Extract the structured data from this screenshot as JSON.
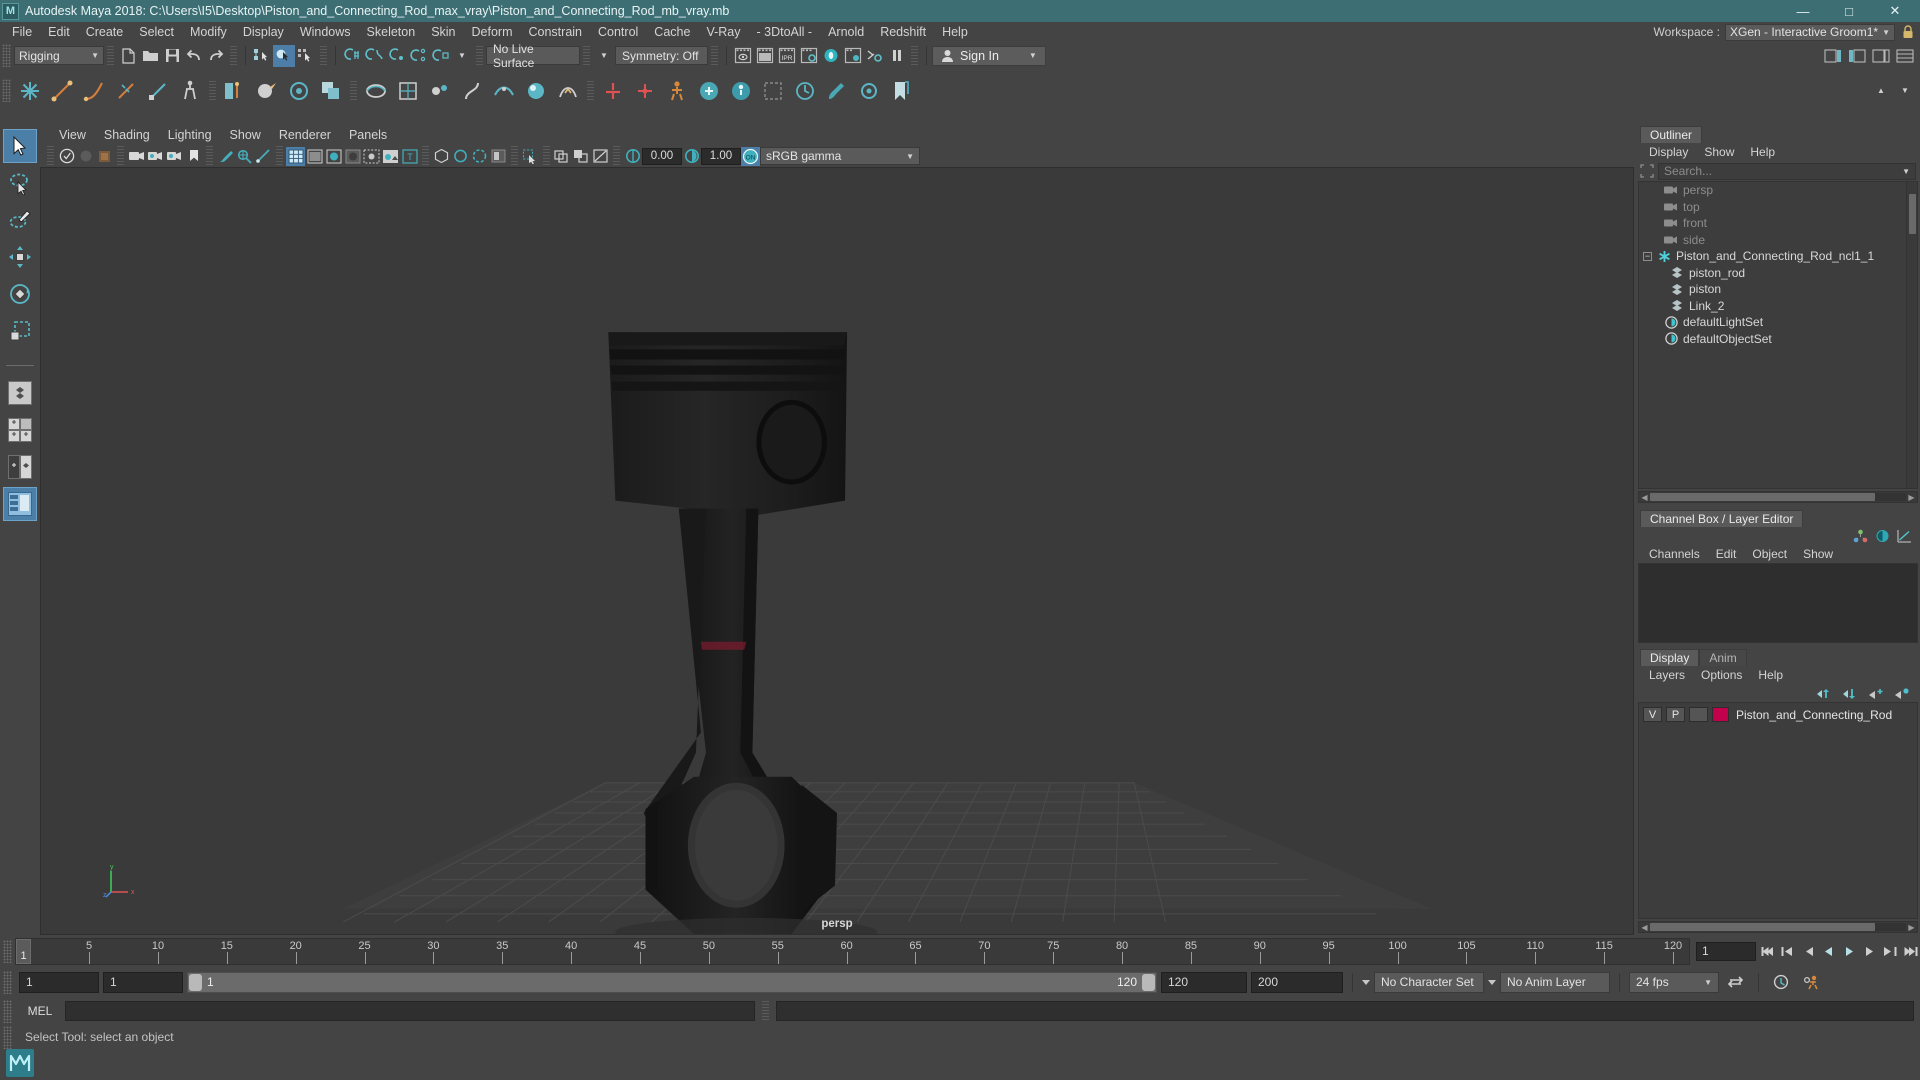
{
  "titlebar": {
    "app_title": "Autodesk Maya 2018: C:\\Users\\I5\\Desktop\\Piston_and_Connecting_Rod_max_vray\\Piston_and_Connecting_Rod_mb_vray.mb",
    "logo": "M",
    "minimize": "—",
    "maximize": "□",
    "close": "✕"
  },
  "menubar": {
    "items": [
      "File",
      "Edit",
      "Create",
      "Select",
      "Modify",
      "Display",
      "Windows",
      "Skeleton",
      "Skin",
      "Deform",
      "Constrain",
      "Control",
      "Cache",
      "V-Ray",
      "- 3DtoAll -",
      "Arnold",
      "Redshift",
      "Help"
    ],
    "workspace_label": "Workspace :",
    "workspace_value": "XGen - Interactive Groom1*"
  },
  "statusline": {
    "mode": "Rigging",
    "live_surface": "No Live Surface",
    "symmetry": "Symmetry: Off",
    "signin": "Sign In"
  },
  "viewport_panel": {
    "menus": [
      "View",
      "Shading",
      "Lighting",
      "Show",
      "Renderer",
      "Panels"
    ],
    "exposure": "0.00",
    "gamma": "1.00",
    "color_space": "sRGB gamma",
    "camera_label": "persp",
    "axis_x": "x",
    "axis_y": "y",
    "axis_z": "z"
  },
  "outliner": {
    "tab": "Outliner",
    "menus": [
      "Display",
      "Show",
      "Help"
    ],
    "search_placeholder": "Search...",
    "items": [
      {
        "label": "persp",
        "icon": "camera-icon",
        "type": "camera",
        "indent": 1
      },
      {
        "label": "top",
        "icon": "camera-icon",
        "type": "camera",
        "indent": 1
      },
      {
        "label": "front",
        "icon": "camera-icon",
        "type": "camera",
        "indent": 1
      },
      {
        "label": "side",
        "icon": "camera-icon",
        "type": "camera",
        "indent": 1
      },
      {
        "label": "Piston_and_Connecting_Rod_ncl1_1",
        "icon": "asterisk-icon",
        "type": "group",
        "indent": 0
      },
      {
        "label": "piston_rod",
        "icon": "mesh-icon",
        "type": "mesh",
        "indent": 2
      },
      {
        "label": "piston",
        "icon": "mesh-icon",
        "type": "mesh",
        "indent": 2
      },
      {
        "label": "Link_2",
        "icon": "mesh-icon",
        "type": "mesh",
        "indent": 2
      },
      {
        "label": "defaultLightSet",
        "icon": "set-icon",
        "type": "set",
        "indent": 1
      },
      {
        "label": "defaultObjectSet",
        "icon": "set-icon",
        "type": "set",
        "indent": 1
      }
    ]
  },
  "channelbox": {
    "tab": "Channel Box / Layer Editor",
    "menus": [
      "Channels",
      "Edit",
      "Object",
      "Show"
    ]
  },
  "layer_editor": {
    "tabs": [
      "Display",
      "Anim"
    ],
    "active_tab": "Display",
    "menus": [
      "Layers",
      "Options",
      "Help"
    ],
    "layers": [
      {
        "visible": "V",
        "playback": "P",
        "type": "",
        "color": "#c2004b",
        "name": "Piston_and_Connecting_Rod"
      }
    ]
  },
  "timeline": {
    "current_frame": "1",
    "ticks": [
      {
        "label": "5",
        "value": 5
      },
      {
        "label": "10",
        "value": 10
      },
      {
        "label": "15",
        "value": 15
      },
      {
        "label": "20",
        "value": 20
      },
      {
        "label": "25",
        "value": 25
      },
      {
        "label": "30",
        "value": 30
      },
      {
        "label": "35",
        "value": 35
      },
      {
        "label": "40",
        "value": 40
      },
      {
        "label": "45",
        "value": 45
      },
      {
        "label": "50",
        "value": 50
      },
      {
        "label": "55",
        "value": 55
      },
      {
        "label": "60",
        "value": 60
      },
      {
        "label": "65",
        "value": 65
      },
      {
        "label": "70",
        "value": 70
      },
      {
        "label": "75",
        "value": 75
      },
      {
        "label": "80",
        "value": 80
      },
      {
        "label": "85",
        "value": 85
      },
      {
        "label": "90",
        "value": 90
      },
      {
        "label": "95",
        "value": 95
      },
      {
        "label": "100",
        "value": 100
      },
      {
        "label": "105",
        "value": 105
      },
      {
        "label": "110",
        "value": 110
      },
      {
        "label": "115",
        "value": 115
      },
      {
        "label": "120",
        "value": 120
      }
    ],
    "frame_field": "1",
    "range_start": "1",
    "range_current": "1",
    "range_bar_start": "1",
    "range_bar_end": "120",
    "range_end": "120",
    "anim_end": "200",
    "character_set": "No Character Set",
    "anim_layer": "No Anim Layer",
    "fps": "24 fps"
  },
  "command_line": {
    "language": "MEL",
    "input_value": "",
    "status": "Select Tool: select an object"
  },
  "colors": {
    "accent_teal": "#3c9aa4",
    "title_bar": "#3c6e74",
    "selection_blue": "#4b7fa8",
    "panel_bg": "#444444",
    "viewport_bg": "#3a3a3a",
    "layer_swatch": "#c2004b"
  }
}
